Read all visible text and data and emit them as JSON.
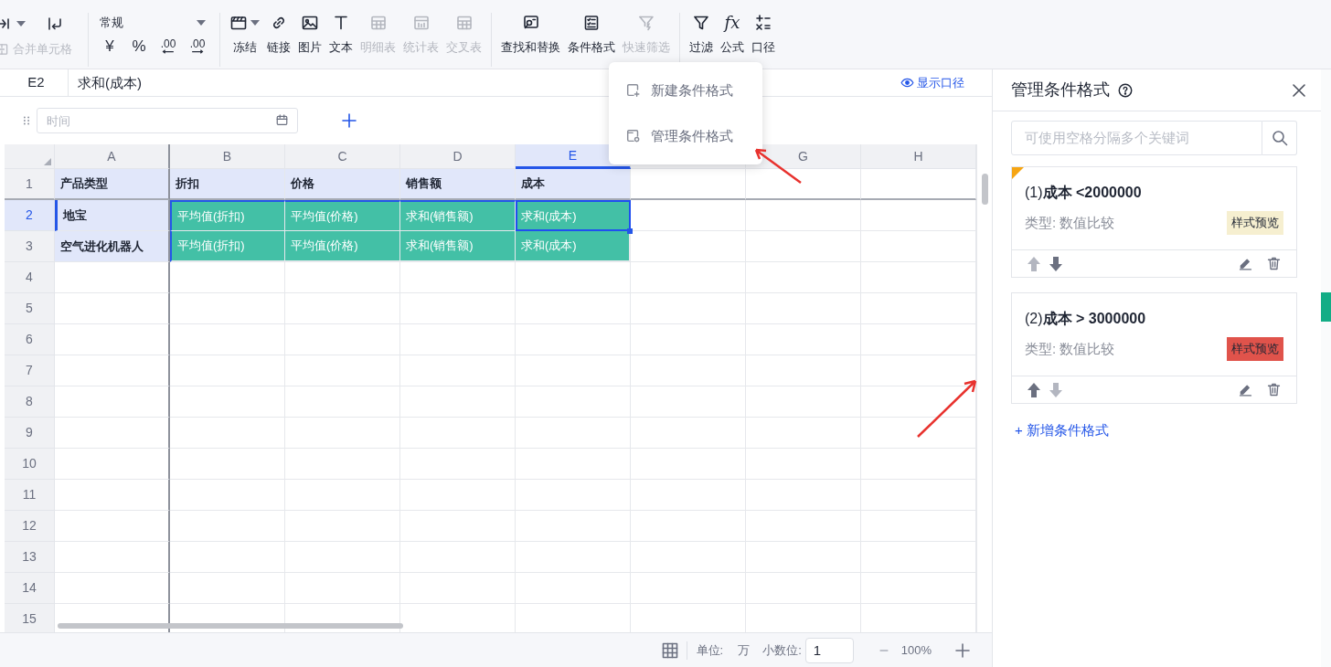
{
  "merge_cells": {
    "label": "合并单元格",
    "disabled": true
  },
  "number_format": {
    "value": "常规"
  },
  "number_buttons": [
    {
      "kind": "glyph",
      "glyph": "¥"
    },
    {
      "kind": "glyph",
      "glyph": "%"
    },
    {
      "kind": "decrease",
      "glyph": ".00"
    },
    {
      "kind": "increase",
      "glyph": ".00"
    }
  ],
  "toolbar_groups": [
    [
      {
        "label": "冻结",
        "disabled": false
      },
      {
        "label": "链接",
        "disabled": false
      },
      {
        "label": "图片",
        "disabled": false
      },
      {
        "label": "文本",
        "disabled": false
      },
      {
        "label": "明细表",
        "disabled": true
      },
      {
        "label": "统计表",
        "disabled": true
      },
      {
        "label": "交叉表",
        "disabled": true
      }
    ],
    [
      {
        "label": "查找和替换",
        "disabled": false
      },
      {
        "label": "条件格式",
        "disabled": false
      },
      {
        "label": "快速筛选",
        "disabled": true
      }
    ],
    [
      {
        "label": "过滤",
        "disabled": false
      },
      {
        "label": "公式",
        "glyph": "fx",
        "disabled": false
      },
      {
        "label": "口径",
        "disabled": false
      }
    ]
  ],
  "formula_bar": {
    "cell": "E2",
    "value": "求和(成本)"
  },
  "show_caliber": {
    "label": "显示口径"
  },
  "time_filter": {
    "placeholder": "时间"
  },
  "menu": [
    {
      "label": "新建条件格式"
    },
    {
      "label": "管理条件格式"
    }
  ],
  "grid": {
    "columns": [
      {
        "label": "A",
        "selected": false
      },
      {
        "label": "B",
        "selected": false
      },
      {
        "label": "C",
        "selected": false
      },
      {
        "label": "D",
        "selected": false
      },
      {
        "label": "E",
        "selected": true
      },
      {
        "selected": false
      },
      {
        "label": "G",
        "selected": false
      },
      {
        "label": "H",
        "selected": false
      }
    ],
    "rows": [
      {
        "number": "1",
        "kind": "header",
        "selected": false,
        "cells": [
          "产品类型",
          "折扣",
          "价格",
          "销售额",
          "成本"
        ]
      },
      {
        "number": "2",
        "kind": "data",
        "selected": true,
        "cells": [
          "地宝",
          "平均值(折扣)",
          "平均值(价格)",
          "求和(销售额)",
          "求和(成本)"
        ]
      },
      {
        "number": "3",
        "kind": "data",
        "selected": false,
        "cells": [
          "空气进化机器人",
          "平均值(折扣)",
          "平均值(价格)",
          "求和(销售额)",
          "求和(成本)"
        ]
      },
      {
        "number": "4",
        "kind": "empty",
        "selected": false
      },
      {
        "number": "5",
        "kind": "empty",
        "selected": false
      },
      {
        "number": "6",
        "kind": "empty",
        "selected": false
      },
      {
        "number": "7",
        "kind": "empty",
        "selected": false
      },
      {
        "number": "8",
        "kind": "empty",
        "selected": false
      },
      {
        "number": "9",
        "kind": "empty",
        "selected": false
      },
      {
        "number": "10",
        "kind": "empty",
        "selected": false
      },
      {
        "number": "11",
        "kind": "empty",
        "selected": false
      },
      {
        "number": "12",
        "kind": "empty",
        "selected": false
      },
      {
        "number": "13",
        "kind": "empty",
        "selected": false
      },
      {
        "number": "14",
        "kind": "empty",
        "selected": false
      },
      {
        "number": "15",
        "kind": "empty",
        "selected": false
      }
    ]
  },
  "status_bar": {
    "unit_label": "单位:",
    "unit": "万",
    "decimals_label": "小数位:",
    "decimals": "1",
    "zoom": "100%"
  },
  "panel": {
    "title": "管理条件格式",
    "search_placeholder": "可使用空格分隔多个关键词",
    "rules": [
      {
        "title": "(1)**成本 <2000000**",
        "type": "类型: 数值比较",
        "preview": "样式预览",
        "color": "#f6efd0",
        "selected": true,
        "up_disabled": true,
        "down_disabled": false
      },
      {
        "title": "(2)**成本 > 3000000**",
        "type": "类型: 数值比较",
        "preview": "样式预览",
        "color": "#e0534b",
        "selected": false,
        "up_disabled": false,
        "down_disabled": true
      }
    ],
    "add_label": "+ 新增条件格式"
  }
}
